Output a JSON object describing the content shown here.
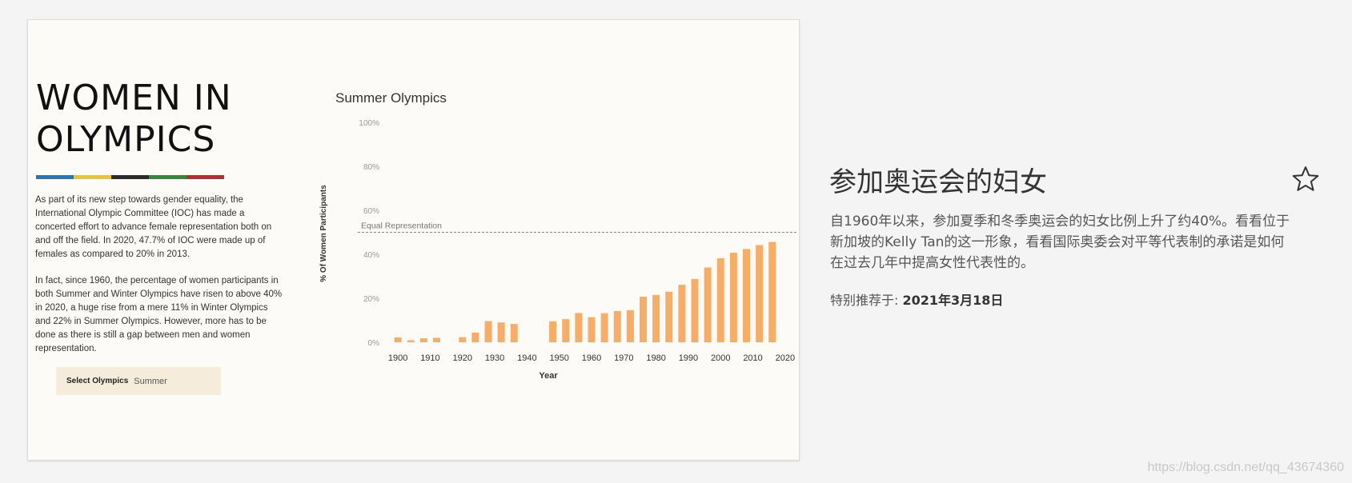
{
  "viz": {
    "title_line1": "WOMEN IN",
    "title_line2": "OLYMPICS",
    "ring_colors": [
      "#1f78c1",
      "#f2c12e",
      "#2b2b2b",
      "#2e8b3a",
      "#c0282f"
    ],
    "paragraph1": "As part of its new step towards gender equality, the International Olympic Committee (IOC) has made a concerted effort to advance female representation both on and off the field. In 2020, 47.7% of IOC were made up of females as compared to 20% in 2013.",
    "paragraph2": "In fact, since 1960, the percentage of women participants in both Summer and Winter Olympics have risen to above 40% in 2020, a huge rise from a mere 11% in Winter Olympics and 22% in Summer Olympics. However, more has to be done as there is still a gap between men and women representation.",
    "filter": {
      "label": "Select Olympics",
      "value": "Summer"
    }
  },
  "chart_data": {
    "type": "bar",
    "title": "Summer Olympics",
    "xlabel": "Year",
    "ylabel": "% Of Women Participants",
    "ylim": [
      0,
      100
    ],
    "yticks": [
      "0%",
      "20%",
      "40%",
      "60%",
      "80%",
      "100%"
    ],
    "xticks": [
      "1900",
      "1910",
      "1920",
      "1930",
      "1940",
      "1950",
      "1960",
      "1970",
      "1980",
      "1990",
      "2000",
      "2010",
      "2020"
    ],
    "reference_line": {
      "label": "Equal Representation",
      "value": 50
    },
    "bar_color": "#f5ad68",
    "x": [
      1900,
      1904,
      1908,
      1912,
      1920,
      1924,
      1928,
      1932,
      1936,
      1948,
      1952,
      1956,
      1960,
      1964,
      1968,
      1972,
      1976,
      1980,
      1984,
      1988,
      1992,
      1996,
      2000,
      2004,
      2008,
      2012,
      2016
    ],
    "values": [
      2.2,
      0.9,
      1.8,
      2.0,
      2.3,
      4.4,
      9.6,
      9.0,
      8.3,
      9.5,
      10.5,
      13.3,
      11.4,
      13.2,
      14.2,
      14.6,
      20.7,
      21.5,
      23.0,
      26.1,
      28.8,
      34.0,
      38.2,
      40.7,
      42.4,
      44.2,
      45.6
    ]
  },
  "panel": {
    "title": "参加奥运会的妇女",
    "description": "自1960年以来，参加夏季和冬季奥运会的妇女比例上升了约40%。看看位于新加坡的Kelly Tan的这一形象，看看国际奥委会对平等代表制的承诺是如何在过去几年中提高女性代表性的。",
    "featured_label": "特别推荐于: ",
    "featured_date": "2021年3月18日",
    "favorite_icon": "star-outline-icon"
  },
  "watermark": "https://blog.csdn.net/qq_43674360"
}
